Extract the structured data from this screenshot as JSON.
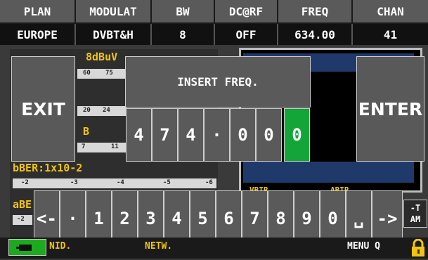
{
  "header": {
    "columns": [
      {
        "label": "PLAN",
        "value": "EUROPE"
      },
      {
        "label": "MODULAT",
        "value": "DVBT&H"
      },
      {
        "label": "BW",
        "value": "8"
      },
      {
        "label": "DC@RF",
        "value": "OFF"
      },
      {
        "label": "FREQ",
        "value": "634.00"
      },
      {
        "label": "CHAN",
        "value": "41"
      }
    ]
  },
  "background": {
    "power_value": "8dBuV",
    "power_scale": [
      "60",
      "75"
    ],
    "cn_scale": [
      "20",
      "24"
    ],
    "mer_unit": "B",
    "mer_scale": [
      "7",
      "11"
    ],
    "bber_label": "bBER:1x10-2",
    "bber_scale": [
      "-2",
      "-3",
      "-4",
      "-5",
      "-6"
    ],
    "aber_label": "aBE",
    "aber_scale": [
      "-2"
    ],
    "vbir_label": "VBIR",
    "abir_label": "ABIR",
    "right_fragment_top": "-T",
    "right_fragment_bottom": "AM",
    "nid_label": "NID.",
    "netw_label": "NETW.",
    "menu_label": "MENU Q"
  },
  "dialog": {
    "exit_label": "EXIT",
    "enter_label": "ENTER",
    "title": "INSERT FREQ.",
    "freq_digits": [
      "4",
      "7",
      "4",
      "·",
      "0",
      "0",
      "0"
    ],
    "active_digit_index": 6
  },
  "keypad": {
    "keys": [
      "<-",
      "·",
      "1",
      "2",
      "3",
      "4",
      "5",
      "6",
      "7",
      "8",
      "9",
      "0",
      "␣",
      "->"
    ]
  },
  "colors": {
    "active_digit": "#13a538",
    "label_yellow": "#f1c40f",
    "lock_icon": "#f1c40f",
    "battery_icon": "#1eaa1e"
  }
}
